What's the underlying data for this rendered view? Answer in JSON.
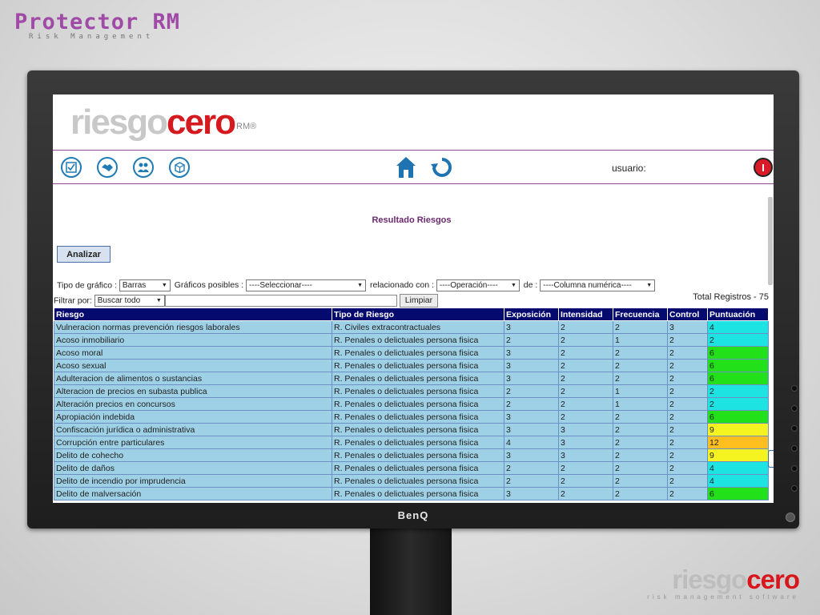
{
  "brand": {
    "title": "Protector RM",
    "subtitle": "Risk Management"
  },
  "corner_logo": {
    "word1": "riesgo",
    "word2": "cero",
    "tagline": "risk management software"
  },
  "monitor": {
    "brand": "BenQ"
  },
  "app": {
    "logo_word1": "riesgo",
    "logo_word2": "cero",
    "logo_mark": "RM®",
    "toolbar_icons": [
      "checklist-icon",
      "handshake-icon",
      "people-icon",
      "box-icon"
    ],
    "user_label": "usuario:",
    "logout_label": "I",
    "section_title": "Resultado Riesgos",
    "analyze_button": "Analizar",
    "controls": {
      "chart_type_label": "Tipo de gráfico :",
      "chart_type_value": "Barras",
      "possible_label": "Gráficos posibles :",
      "possible_value": "----Seleccionar----",
      "related_label": "relacionado con :",
      "operation_value": "----Operación----",
      "of_label": "de :",
      "numeric_value": "----Columna numérica----",
      "filter_label": "Filtrar por:",
      "filter_value": "Buscar todo",
      "clear_button": "Limpiar",
      "total": "Total Registros - 75"
    },
    "table": {
      "headers": [
        "Riesgo",
        "Tipo de Riesgo",
        "Exposición",
        "Intensidad",
        "Frecuencia",
        "Control",
        "Puntuación"
      ],
      "rows": [
        [
          "Vulneracion normas prevención riesgos laborales",
          "R. Civiles extracontractuales",
          "3",
          "2",
          "2",
          "3",
          "4"
        ],
        [
          "Acoso inmobiliario",
          "R. Penales o delictuales persona fisica",
          "2",
          "2",
          "1",
          "2",
          "2"
        ],
        [
          "Acoso moral",
          "R. Penales o delictuales persona fisica",
          "3",
          "2",
          "2",
          "2",
          "6"
        ],
        [
          "Acoso sexual",
          "R. Penales o delictuales persona fisica",
          "3",
          "2",
          "2",
          "2",
          "6"
        ],
        [
          "Adulteracion de alimentos o sustancias",
          "R. Penales o delictuales persona fisica",
          "3",
          "2",
          "2",
          "2",
          "6"
        ],
        [
          "Alteracion de precios en subasta publica",
          "R. Penales o delictuales persona fisica",
          "2",
          "2",
          "1",
          "2",
          "2"
        ],
        [
          "Alteración precios en concursos",
          "R. Penales o delictuales persona fisica",
          "2",
          "2",
          "1",
          "2",
          "2"
        ],
        [
          "Apropiación indebida",
          "R. Penales o delictuales persona fisica",
          "3",
          "2",
          "2",
          "2",
          "6"
        ],
        [
          "Confiscación jurídica o administrativa",
          "R. Penales o delictuales persona fisica",
          "3",
          "3",
          "2",
          "2",
          "9"
        ],
        [
          "Corrupción entre particulares",
          "R. Penales o delictuales persona fisica",
          "4",
          "3",
          "2",
          "2",
          "12"
        ],
        [
          "Delito de cohecho",
          "R. Penales o delictuales persona fisica",
          "3",
          "3",
          "2",
          "2",
          "9"
        ],
        [
          "Delito de daños",
          "R. Penales o delictuales persona fisica",
          "2",
          "2",
          "2",
          "2",
          "4"
        ],
        [
          "Delito de incendio por imprudencia",
          "R. Penales o delictuales persona fisica",
          "2",
          "2",
          "2",
          "2",
          "4"
        ],
        [
          "Delito de malversación",
          "R. Penales o delictuales persona fisica",
          "3",
          "2",
          "2",
          "2",
          "6"
        ]
      ]
    },
    "score_colors": {
      "2": "#1de3e3",
      "4": "#1de3e3",
      "6": "#22e01a",
      "9": "#f6f420",
      "12": "#ffbf1f"
    }
  }
}
